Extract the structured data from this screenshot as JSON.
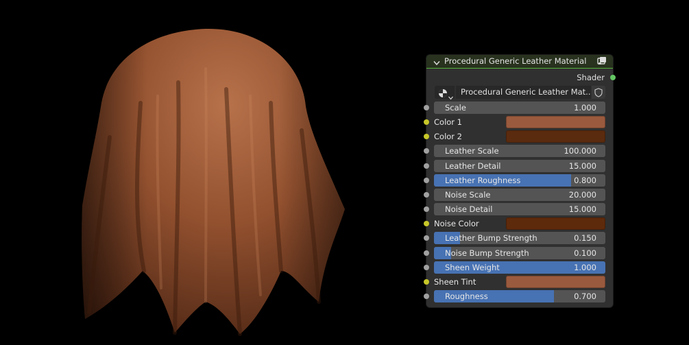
{
  "node": {
    "title": "Procedural Generic Leather Material",
    "output_label": "Shader",
    "material_name": "Procedural Generic Leather Mat...",
    "colors": {
      "header_bg": "#28321e",
      "body_bg": "#303030",
      "slider_bg": "#545454",
      "slider_fill": "#4772b3",
      "socket_float": "#a1a1a1",
      "socket_color": "#c7c729",
      "socket_shader": "#63c763"
    },
    "icons": {
      "collapse": "chevron-down-icon",
      "node_type": "node-group-icon",
      "material": "material-sphere-icon",
      "shield": "fake-user-shield-icon"
    },
    "inputs": [
      {
        "label": "Scale",
        "value": "1.000",
        "type": "slider",
        "fill": 0
      },
      {
        "label": "Color 1",
        "type": "color",
        "color": "#9a5a3e"
      },
      {
        "label": "Color 2",
        "type": "color",
        "color": "#5b2b0f"
      },
      {
        "label": "Leather Scale",
        "value": "100.000",
        "type": "slider",
        "fill": 0
      },
      {
        "label": "Leather Detail",
        "value": "15.000",
        "type": "slider",
        "fill": 0
      },
      {
        "label": "Leather Roughness",
        "value": "0.800",
        "type": "slider",
        "fill": 0.8
      },
      {
        "label": "Noise Scale",
        "value": "20.000",
        "type": "slider",
        "fill": 0
      },
      {
        "label": "Noise Detail",
        "value": "15.000",
        "type": "slider",
        "fill": 0
      },
      {
        "label": "Noise Color",
        "type": "color",
        "color": "#5e2a0c"
      },
      {
        "label": "Leather Bump Strength",
        "value": "0.150",
        "type": "slider",
        "fill": 0.15
      },
      {
        "label": "Noise Bump Strength",
        "value": "0.100",
        "type": "slider",
        "fill": 0.1
      },
      {
        "label": "Sheen Weight",
        "value": "1.000",
        "type": "slider",
        "fill": 1.0
      },
      {
        "label": "Sheen Tint",
        "type": "color",
        "color": "#9a5a3e"
      },
      {
        "label": "Roughness",
        "value": "0.700",
        "type": "slider",
        "fill": 0.7
      }
    ]
  }
}
